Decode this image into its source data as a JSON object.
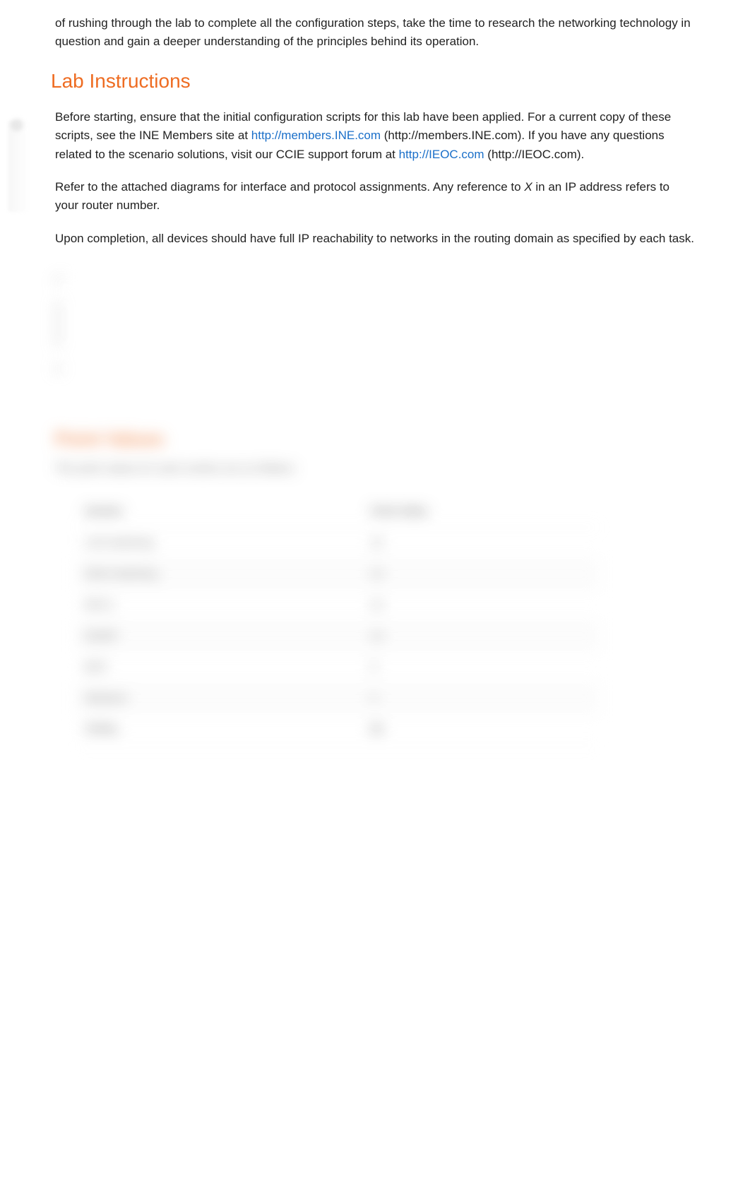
{
  "intro": "of rushing through the lab to complete all the configuration steps, take the time to research the networking technology in question and gain a deeper understanding of the principles behind its operation.",
  "lab_instructions_heading": "Lab Instructions",
  "lab_p1_prefix": "Before starting, ensure that the initial configuration scripts for this lab have been applied. For a current copy of these scripts, see the INE Members site at ",
  "lab_p1_link1_text": "http://members.INE.com",
  "lab_p1_paren1": " (http://members.INE.com). If you have any questions related to the scenario solutions, visit our CCIE support forum at ",
  "lab_p1_link2_text": "http://IEOC.com",
  "lab_p1_paren2": " (http://IEOC.com).",
  "lab_p2_prefix": "Refer to the attached diagrams for interface and protocol assignments. Any reference to ",
  "lab_p2_x": "X",
  "lab_p2_suffix": " in an IP address refers to your router number.",
  "lab_p3": "Upon completion, all devices should have full IP reachability to networks in the routing domain as specified by each task.",
  "point_values_heading": "Point Values",
  "point_values_sub": "The point values for each section are as follows:",
  "table": {
    "head_section": "Section",
    "head_points": "Point Value",
    "rows": [
      {
        "section": "LAN Switching",
        "points": "10"
      },
      {
        "section": "WAN Switching",
        "points": "10"
      },
      {
        "section": "MPLS",
        "points": "10"
      },
      {
        "section": "EIGRP",
        "points": "10"
      },
      {
        "section": "BGP",
        "points": "5"
      },
      {
        "section": "Multicast",
        "points": "5"
      }
    ],
    "totals_label": "TOTAL",
    "totals_value": "50"
  }
}
